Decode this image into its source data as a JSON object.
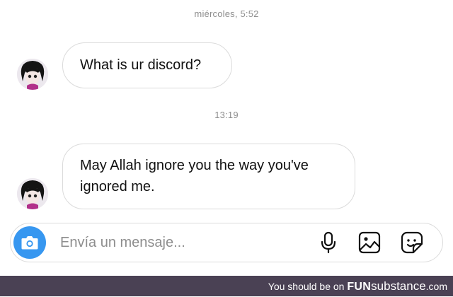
{
  "thread": {
    "timestamp_1": "miércoles, 5:52",
    "timestamp_2": "13:19",
    "messages": [
      {
        "text": "What is ur discord?"
      },
      {
        "text": "May Allah ignore you the way you've ignored me."
      }
    ]
  },
  "composer": {
    "placeholder": "Envía un mensaje...",
    "value": ""
  },
  "watermark": {
    "prefix": "You should be on ",
    "brand_bold": "FUN",
    "brand_rest": "substance",
    "suffix": ".com"
  },
  "colors": {
    "camera_button": "#3797f0",
    "bubble_border": "#dbdbdb",
    "timestamp": "#8e8e8e",
    "footer_bg": "#4a4154"
  },
  "icons": {
    "camera": "camera-icon",
    "mic": "microphone-icon",
    "gallery": "image-gallery-icon",
    "sticker": "sticker-icon"
  }
}
